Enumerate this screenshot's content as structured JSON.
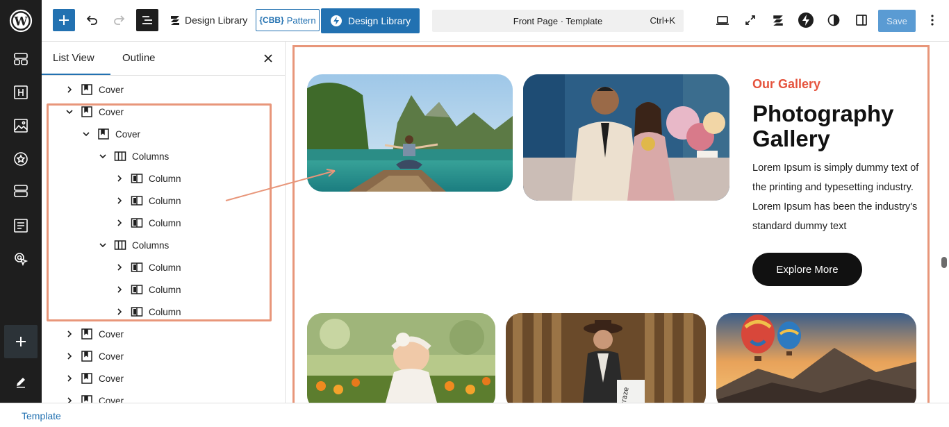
{
  "toolbar": {
    "design_library_label": "Design Library",
    "pattern_prefix": "{CBB}",
    "pattern_label": "Pattern",
    "design_library_button": "Design Library",
    "command_title": "Front Page · Template",
    "command_shortcut": "Ctrl+K",
    "save_label": "Save"
  },
  "sidebar": {
    "tabs": [
      "List View",
      "Outline"
    ],
    "tree": [
      {
        "label": "Cover",
        "expanded": false,
        "icon": "cover-icon"
      },
      {
        "label": "Cover",
        "expanded": true,
        "icon": "cover-icon"
      },
      {
        "label": "Cover",
        "expanded": true,
        "icon": "cover-icon"
      },
      {
        "label": "Columns",
        "expanded": true,
        "icon": "columns-icon"
      },
      {
        "label": "Column",
        "expanded": false,
        "icon": "column-icon"
      },
      {
        "label": "Column",
        "expanded": false,
        "icon": "column-icon"
      },
      {
        "label": "Column",
        "expanded": false,
        "icon": "column-icon"
      },
      {
        "label": "Columns",
        "expanded": true,
        "icon": "columns-icon"
      },
      {
        "label": "Column",
        "expanded": false,
        "icon": "column-icon"
      },
      {
        "label": "Column",
        "expanded": false,
        "icon": "column-icon"
      },
      {
        "label": "Column",
        "expanded": false,
        "icon": "column-icon"
      },
      {
        "label": "Cover",
        "expanded": false,
        "icon": "cover-icon"
      },
      {
        "label": "Cover",
        "expanded": false,
        "icon": "cover-icon"
      },
      {
        "label": "Cover",
        "expanded": false,
        "icon": "cover-icon"
      },
      {
        "label": "Cover",
        "expanded": false,
        "icon": "cover-icon"
      }
    ]
  },
  "canvas": {
    "subtitle": "Our Gallery",
    "title": "Photography Gallery",
    "description": "Lorem Ipsum is simply dummy text of the printing and typesetting industry. Lorem Ipsum has been the industry's standard dummy text",
    "button_label": "Explore More",
    "photos": [
      "lake-boat-photo",
      "wedding-couple-photo",
      "baby-flowers-photo",
      "fashion-woman-photo",
      "hot-air-balloons-photo"
    ]
  },
  "footer": {
    "breadcrumb": "Template"
  },
  "colors": {
    "accent": "#2271b1",
    "highlight": "#e8967a",
    "subtitle_red": "#e5533d",
    "rail": "#1e1e1e"
  }
}
